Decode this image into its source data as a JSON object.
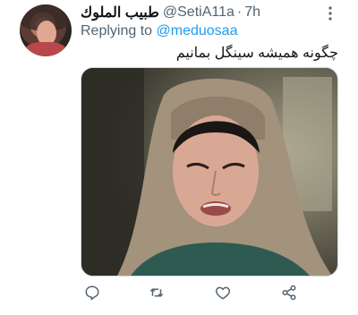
{
  "tweet": {
    "display_name": "طبيب الملوك",
    "handle": "@SetiA11a",
    "separator": "·",
    "time": "7h",
    "replying_prefix": "Replying to",
    "replying_to": "@meduosaa",
    "text": "چگونه همیشه سینگل بمانیم"
  },
  "icons": {
    "more": "more-options-icon",
    "reply": "reply-icon",
    "retweet": "retweet-icon",
    "like": "heart-icon",
    "share": "share-icon"
  },
  "colors": {
    "text": "#0f1419",
    "secondary": "#536471",
    "link": "#1d9bf0"
  }
}
